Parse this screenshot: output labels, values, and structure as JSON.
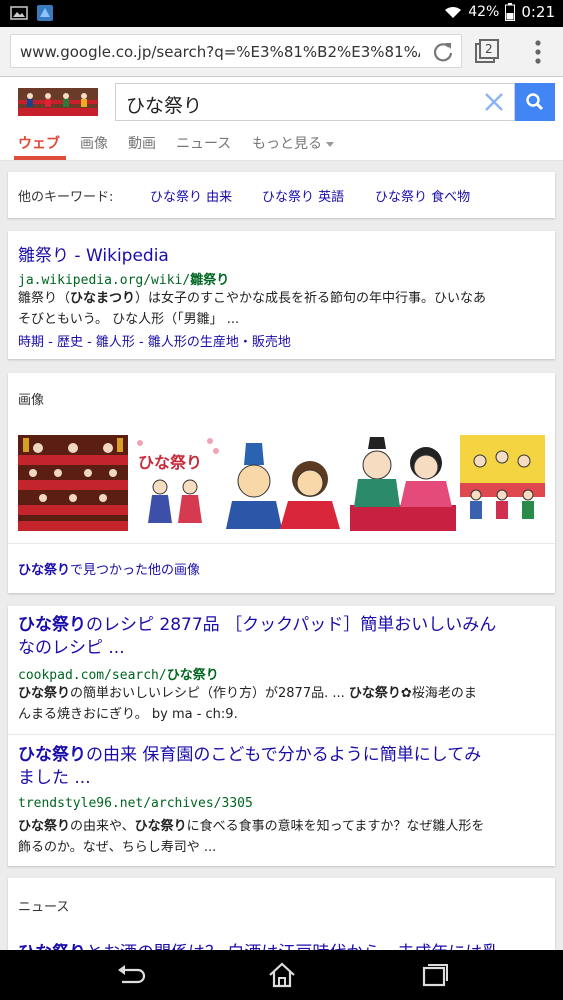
{
  "status": {
    "battery_pct": "42%",
    "time": "0:21"
  },
  "browser": {
    "url": "www.google.co.jp/search?q=%E3%81%B2%E3%81%AA%E7",
    "tab_count": "2"
  },
  "search": {
    "query": "ひな祭り"
  },
  "nav": {
    "tabs": [
      "ウェブ",
      "画像",
      "動画",
      "ニュース",
      "もっと見る"
    ]
  },
  "keywords": {
    "label": "他のキーワード:",
    "items": [
      "ひな祭り 由来",
      "ひな祭り 英語",
      "ひな祭り 食べ物"
    ]
  },
  "wiki": {
    "title": "雛祭り - Wikipedia",
    "cite_host": "ja.wikipedia.org/wiki/",
    "cite_term": "雛祭り",
    "snip_1a": "雛祭り（",
    "snip_1b": "ひなまつり",
    "snip_1c": "）は女子のすこやかな成長を祈る節句の年中行事。ひいなあ",
    "snip_2": "そびともいう。 ひな人形（「男雛」 ...",
    "sitelinks": "時期 - 歴史 - 雛人形 - 雛人形の生産地・販売地"
  },
  "images": {
    "label": "画像",
    "thumb_2_text": "ひな祭り",
    "more_term": "ひな祭り",
    "more_rest": "で見つかった他の画像"
  },
  "results": [
    {
      "title_term": "ひな祭り",
      "title_line1": "のレシピ 2877品 ［クックパッド］簡単おいしいみん",
      "title_line2": "なのレシピ ...",
      "cite_host": "cookpad.com/search/",
      "cite_term": "ひな祭り",
      "snip_l1_a": "ひな祭り",
      "snip_l1_b": "の簡単おいしいレシピ（作り方）が2877品. ... ",
      "snip_l1_c": "ひな祭り",
      "snip_l1_d": "✿桜海老のま",
      "snip_l2": "んまる焼きおにぎり。 by ma - ch:9."
    },
    {
      "title_term": "ひな祭り",
      "title_line1": "の由来 保育園のこどもで分かるように簡単にしてみ",
      "title_line2": "ました ...",
      "cite": "trendstyle96.net/archives/3305",
      "snip_l1_a": "ひな祭り",
      "snip_l1_b": "の由来や、",
      "snip_l1_c": "ひな祭り",
      "snip_l1_d": "に食べる食事の意味を知ってますか？なぜ雛人形を",
      "snip_l2": "飾るのか。なぜ、ちらし寿司や ..."
    }
  ],
  "news": {
    "label": "ニュース",
    "title_term": "ひな祭り",
    "title_rest": "とお酒の関係は？ 白酒は江戸時代から、未成年には乳"
  },
  "colors": {
    "link": "#1a0dab",
    "cite": "#006621",
    "accent": "#dd4b39",
    "search_button": "#4285f4"
  }
}
